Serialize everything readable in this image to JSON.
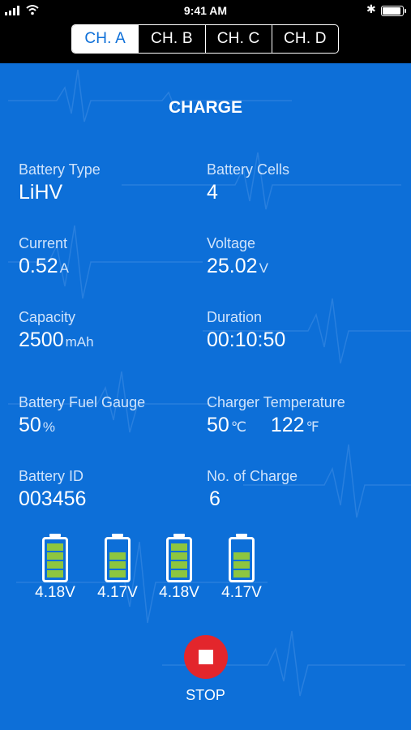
{
  "status": {
    "time": "9:41 AM",
    "signal_icon": "signal-icon",
    "wifi_icon": "wifi-icon",
    "bluetooth_icon": "bluetooth-icon",
    "battery_icon": "battery-icon"
  },
  "tabs": [
    {
      "label": "CH. A",
      "active": true
    },
    {
      "label": "CH. B",
      "active": false
    },
    {
      "label": "CH. C",
      "active": false
    },
    {
      "label": "CH. D",
      "active": false
    }
  ],
  "title": "CHARGE",
  "fields": {
    "battery_type": {
      "label": "Battery Type",
      "value": "LiHV"
    },
    "battery_cells": {
      "label": "Battery Cells",
      "value": "4"
    },
    "current": {
      "label": "Current",
      "value": "0.52",
      "unit": "A"
    },
    "voltage": {
      "label": "Voltage",
      "value": "25.02",
      "unit": "V"
    },
    "capacity": {
      "label": "Capacity",
      "value": "2500",
      "unit": "mAh"
    },
    "duration": {
      "label": "Duration",
      "value": "00:10:50"
    },
    "fuel_gauge": {
      "label": "Battery Fuel Gauge",
      "value": "50",
      "unit": "%"
    },
    "charger_temp": {
      "label": "Charger Temperature",
      "celsius": "50",
      "celsius_unit": "℃",
      "fahrenheit": "122",
      "fahrenheit_unit": "℉"
    },
    "battery_id": {
      "label": "Battery ID",
      "value": "003456"
    },
    "charge_count": {
      "label": "No. of Charge",
      "value": "6"
    }
  },
  "cells": [
    {
      "voltage": "4.18V",
      "level": 4
    },
    {
      "voltage": "4.17V",
      "level": 3
    },
    {
      "voltage": "4.18V",
      "level": 4
    },
    {
      "voltage": "4.17V",
      "level": 3
    }
  ],
  "stop": {
    "label": "STOP",
    "icon": "stop-icon"
  },
  "colors": {
    "background": "#0d6fd8",
    "cell_bar": "#8dc63f",
    "stop_button": "#e3262c"
  }
}
